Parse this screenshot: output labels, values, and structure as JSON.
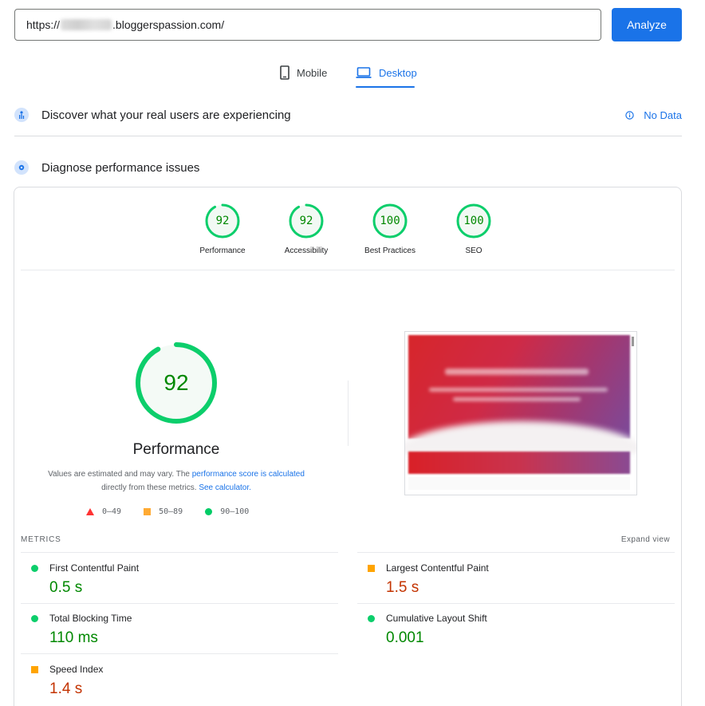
{
  "url_bar": {
    "prefix": "https://",
    "suffix": ".bloggerspassion.com/",
    "analyze_label": "Analyze"
  },
  "tabs": [
    {
      "label": "Mobile",
      "icon": "phone-icon",
      "active": false
    },
    {
      "label": "Desktop",
      "icon": "laptop-icon",
      "active": true
    }
  ],
  "field_section": {
    "title": "Discover what your real users are experiencing",
    "status": "No Data"
  },
  "lab_section": {
    "title": "Diagnose performance issues"
  },
  "scores": [
    {
      "label": "Performance",
      "value": "92"
    },
    {
      "label": "Accessibility",
      "value": "92"
    },
    {
      "label": "Best Practices",
      "value": "100"
    },
    {
      "label": "SEO",
      "value": "100"
    }
  ],
  "performance": {
    "score": "92",
    "title": "Performance",
    "note_prefix": "Values are estimated and may vary. The ",
    "note_link1": "performance score is calculated",
    "note_mid": " directly from these metrics. ",
    "note_link2": "See calculator."
  },
  "legend": [
    {
      "range": "0–49",
      "shape": "triangle",
      "color": "#ff3333"
    },
    {
      "range": "50–89",
      "shape": "square",
      "color": "#ffaa33"
    },
    {
      "range": "90–100",
      "shape": "circle",
      "color": "#00cc66"
    }
  ],
  "metrics": {
    "header": "METRICS",
    "expand_label": "Expand view",
    "items": [
      {
        "label": "First Contentful Paint",
        "value": "0.5 s",
        "rating": "green"
      },
      {
        "label": "Largest Contentful Paint",
        "value": "1.5 s",
        "rating": "orange"
      },
      {
        "label": "Total Blocking Time",
        "value": "110 ms",
        "rating": "green"
      },
      {
        "label": "Cumulative Layout Shift",
        "value": "0.001",
        "rating": "green"
      },
      {
        "label": "Speed Index",
        "value": "1.4 s",
        "rating": "orange"
      }
    ]
  },
  "colors": {
    "accent": "#1a73e8",
    "pass": "#0cce6b",
    "pass_text": "#008800",
    "average": "#ffa400",
    "average_text": "#c33300"
  }
}
